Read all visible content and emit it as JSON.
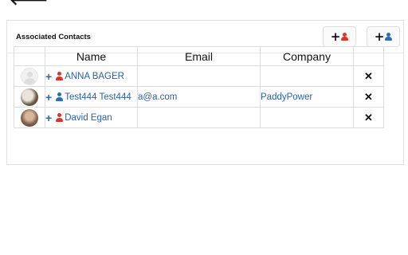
{
  "header": {
    "title": "Associated Contacts",
    "back": "🡐"
  },
  "buttons": {
    "add_plus": "+"
  },
  "table": {
    "columns": [
      "",
      "Name",
      "Email",
      "Company",
      ""
    ],
    "rows": [
      {
        "avatar": "blank-avatar",
        "add": "+",
        "person_color": "#d9362b",
        "name": "ANNA BAGER",
        "email": "",
        "company": "",
        "remove": "✕"
      },
      {
        "avatar": "photo-avatar",
        "add": "+",
        "person_color": "#2a6fb3",
        "name": "Test444 Test444",
        "email": "a@a.com",
        "company": "PaddyPower",
        "remove": "✕"
      },
      {
        "avatar": "photo-avatar",
        "add": "+",
        "person_color": "#d9362b",
        "name": "David Egan",
        "email": "",
        "company": "",
        "remove": "✕"
      }
    ]
  },
  "colors": {
    "link": "#2a5fa5",
    "red_person": "#d9362b",
    "blue_person": "#2a6fb3"
  }
}
